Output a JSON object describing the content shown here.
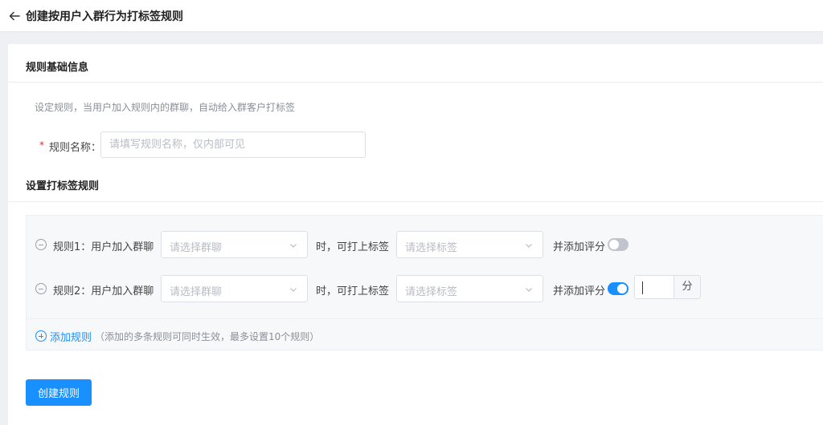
{
  "header": {
    "title": "创建按用户入群行为打标签规则"
  },
  "basic": {
    "title": "规则基础信息",
    "description": "设定规则，当用户加入规则内的群聊，自动给入群客户打标签",
    "name_required_mark": "*",
    "name_label": "规则名称：",
    "name_placeholder": "请填写规则名称，仅内部可见"
  },
  "tagging": {
    "title": "设置打标签规则",
    "rules": [
      {
        "label": "规则1：用户加入群聊",
        "group_placeholder": "请选择群聊",
        "mid_label": "时，可打上标签",
        "tag_placeholder": "请选择标签",
        "score_label": "并添加评分",
        "score_enabled": false
      },
      {
        "label": "规则2：用户加入群聊",
        "group_placeholder": "请选择群聊",
        "mid_label": "时，可打上标签",
        "tag_placeholder": "请选择标签",
        "score_label": "并添加评分",
        "score_enabled": true,
        "score_value": "",
        "score_unit": "分"
      }
    ],
    "add_label": "添加规则",
    "add_hint": "（添加的多条规则可同时生效，最多设置10个规则）"
  },
  "actions": {
    "create_label": "创建规则"
  },
  "colors": {
    "accent": "#1890ff",
    "required": "#f5222d",
    "toggle_off": "#c0c4cc"
  },
  "icons": {
    "back": "arrow-left-icon",
    "remove": "minus-circle-icon",
    "add": "plus-circle-icon",
    "dropdown": "chevron-down-icon"
  }
}
